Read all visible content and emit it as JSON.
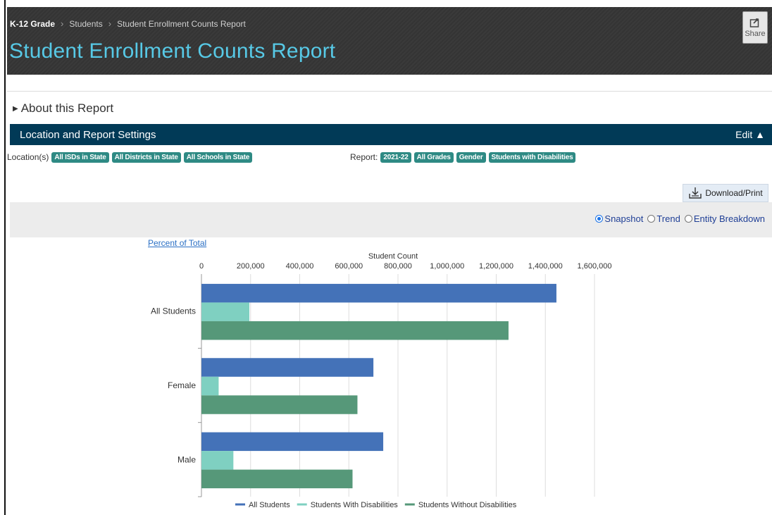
{
  "breadcrumb": {
    "home": "K-12 Grade",
    "section": "Students",
    "current": "Student Enrollment Counts Report"
  },
  "page_title": "Student Enrollment Counts Report",
  "share_label": "Share",
  "about_label": "About this Report",
  "settings": {
    "title": "Location and Report Settings",
    "edit_label": "Edit ▲"
  },
  "location": {
    "label": "Location(s)",
    "chips": [
      "All ISDs in State",
      "All Districts in State",
      "All Schools in State"
    ]
  },
  "report": {
    "label": "Report:",
    "chips": [
      "2021-22",
      "All Grades",
      "Gender",
      "Students with Disabilities"
    ]
  },
  "download_label": "Download/Print",
  "view_options": [
    {
      "label": "Snapshot",
      "checked": true
    },
    {
      "label": "Trend",
      "checked": false
    },
    {
      "label": "Entity Breakdown",
      "checked": false
    }
  ],
  "percent_of_total_label": "Percent of Total",
  "colors": {
    "all": "#4472b8",
    "with": "#7fd0c1",
    "without": "#569879",
    "header_bar": "#013a57",
    "title": "#57c9e6",
    "chip": "#2e8a84"
  },
  "chart_data": {
    "type": "bar",
    "orientation": "horizontal",
    "title": "Student Count",
    "categories": [
      "All Students",
      "Female",
      "Male"
    ],
    "series": [
      {
        "name": "All Students",
        "values": [
          1445000,
          700000,
          740000
        ]
      },
      {
        "name": "Students With Disabilities",
        "values": [
          195000,
          70000,
          130000
        ]
      },
      {
        "name": "Students Without Disabilities",
        "values": [
          1250000,
          635000,
          615000
        ]
      }
    ],
    "xlim": [
      0,
      1600000
    ],
    "ticks": [
      0,
      200000,
      400000,
      600000,
      800000,
      1000000,
      1200000,
      1400000,
      1600000
    ],
    "tick_labels": [
      "0",
      "200,000",
      "400,000",
      "600,000",
      "800,000",
      "1,000,000",
      "1,200,000",
      "1,400,000",
      "1,600,000"
    ],
    "axis_position": "top",
    "grid": true,
    "legend_position": "bottom"
  }
}
